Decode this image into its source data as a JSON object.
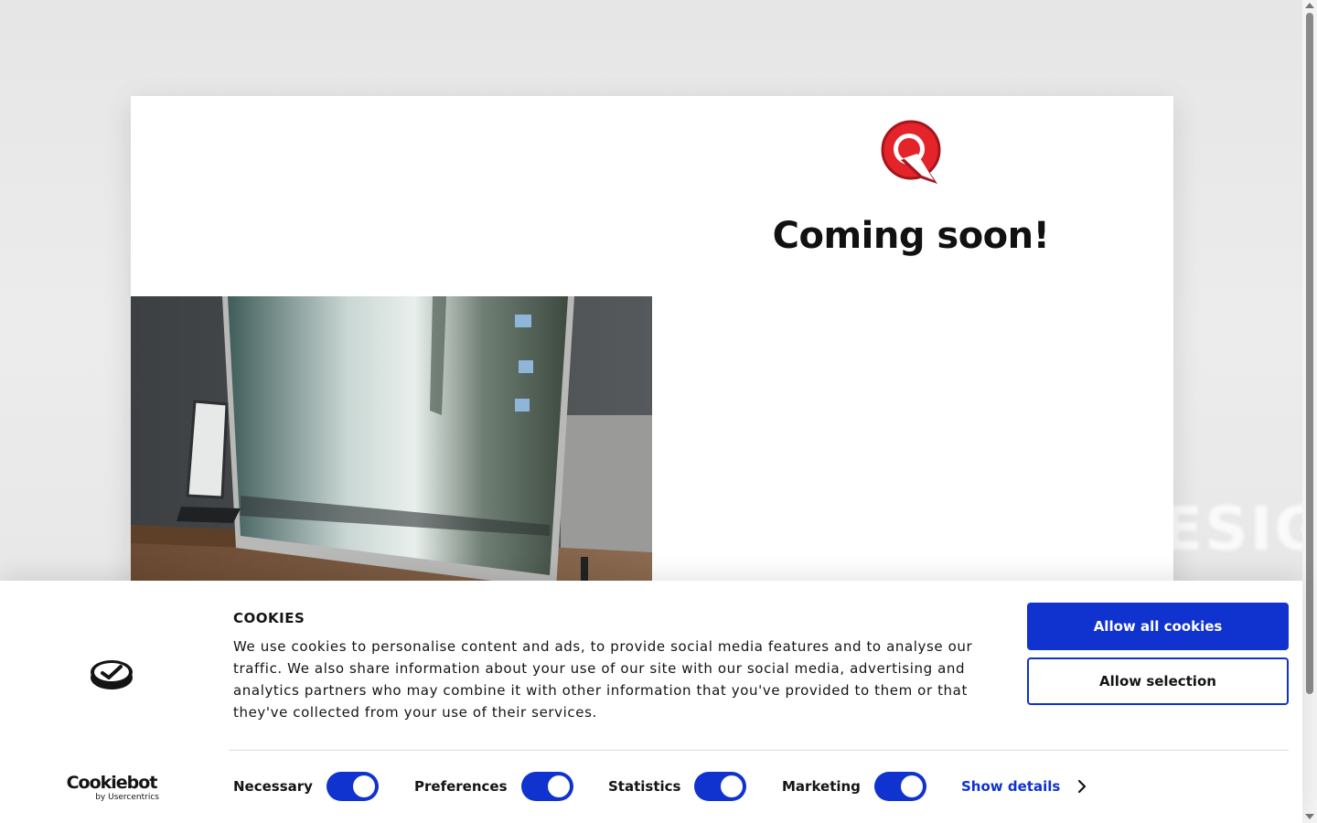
{
  "background": {
    "design_text": "ESIGN"
  },
  "content": {
    "title": "Coming soon!",
    "logo_icon": "brand-logo-icon",
    "image_icon": "desk-monitor-photo"
  },
  "cookie_banner": {
    "title": "COOKIES",
    "text": "We use cookies to personalise content and ads, to provide social media features and to analyse our traffic. We also share information about your use of our site with our social media, advertising and analytics partners who may combine it with other information that you've provided to them or that they've collected from your use of their services.",
    "allow_all_label": "Allow all cookies",
    "allow_selection_label": "Allow selection",
    "brand": {
      "name": "Cookiebot",
      "sub": "by Usercentrics"
    },
    "categories": [
      {
        "label": "Necessary",
        "checked": true
      },
      {
        "label": "Preferences",
        "checked": true
      },
      {
        "label": "Statistics",
        "checked": true
      },
      {
        "label": "Marketing",
        "checked": true
      }
    ],
    "show_details_label": "Show details",
    "accent_color": "#1032cf"
  }
}
